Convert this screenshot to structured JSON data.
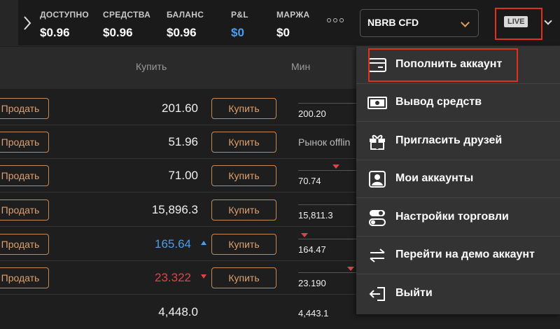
{
  "header": {
    "stats": [
      {
        "label": "ДОСТУПНО",
        "value": "$0.96"
      },
      {
        "label": "СРЕДСТВА",
        "value": "$0.96"
      },
      {
        "label": "БАЛАНС",
        "value": "$0.96"
      },
      {
        "label": "P&L",
        "value": "$0"
      },
      {
        "label": "МАРЖА",
        "value": "$0"
      }
    ],
    "instrument": "NBRB CFD",
    "account_mode": "LIVE"
  },
  "table": {
    "col_buy": "Купить",
    "col_min": "Мин",
    "sell_label": "Продать",
    "buy_label": "Купить",
    "rows": [
      {
        "price": "201.60",
        "min": "200.20"
      },
      {
        "price": "51.96",
        "min": "Рынок offlin"
      },
      {
        "price": "71.00",
        "min": "70.74"
      },
      {
        "price": "15,896.3",
        "min": "15,811.3"
      },
      {
        "price": "165.64",
        "min": "164.47"
      },
      {
        "price": "23.322",
        "min": "23.190"
      },
      {
        "price": "4,448.0",
        "min": "4,443.1"
      }
    ]
  },
  "menu": {
    "items": [
      {
        "label": "Пополнить аккаунт",
        "icon": "card-icon"
      },
      {
        "label": "Вывод средств",
        "icon": "cash-icon"
      },
      {
        "label": "Пригласить друзей",
        "icon": "gift-icon"
      },
      {
        "label": "Мои аккаунты",
        "icon": "user-icon"
      },
      {
        "label": "Настройки торговли",
        "icon": "toggles-icon"
      },
      {
        "label": "Перейти на демо аккаунт",
        "icon": "swap-icon"
      },
      {
        "label": "Выйти",
        "icon": "logout-icon"
      }
    ]
  }
}
